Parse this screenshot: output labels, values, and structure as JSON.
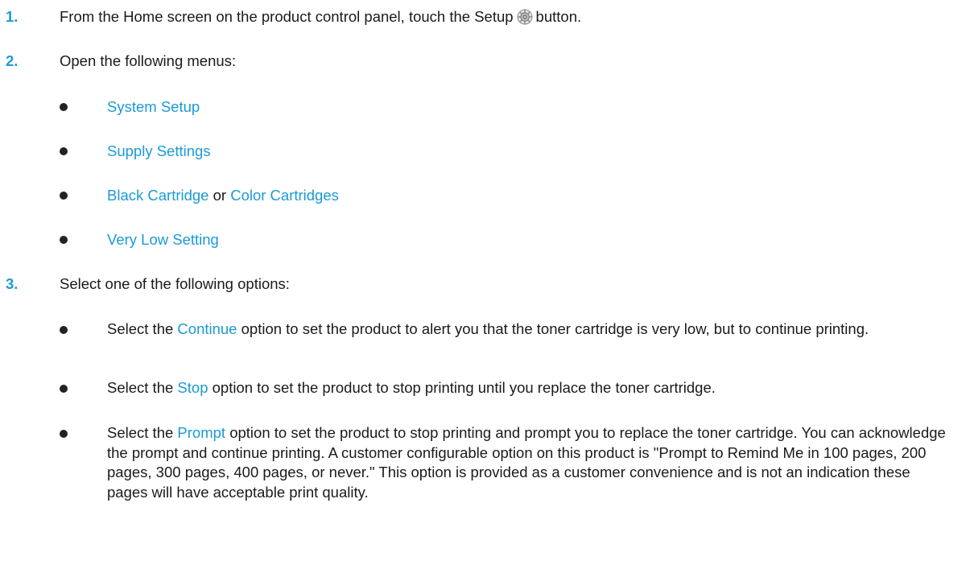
{
  "steps": [
    {
      "number": "1.",
      "before_icon": "From the Home screen on the product control panel, touch the Setup",
      "icon": "setup-gear-icon",
      "after_icon": "button."
    },
    {
      "number": "2.",
      "text": "Open the following menus:"
    },
    {
      "number": "3.",
      "text": "Select one of the following options:"
    }
  ],
  "menus": [
    {
      "term": "System Setup"
    },
    {
      "term": "Supply Settings"
    },
    {
      "term": "Black Cartridge",
      "connector": "or",
      "term2": "Color Cartridges"
    },
    {
      "term": "Very Low Setting"
    }
  ],
  "options": [
    {
      "prefix": "Select the",
      "term": "Continue",
      "suffix": "option to set the product to alert you that the toner cartridge is very low, but to continue printing."
    },
    {
      "prefix": "Select the",
      "term": "Stop",
      "suffix": "option to set the product to stop printing until you replace the toner cartridge."
    },
    {
      "prefix": "Select the",
      "term": "Prompt",
      "suffix": "option to set the product to stop printing and prompt you to replace the toner cartridge. You can acknowledge the prompt and continue printing. A customer configurable option on this product is \"Prompt to Remind Me in 100 pages, 200 pages, 300 pages, 400 pages, or never.\" This option is provided as a customer convenience and is not an indication these pages will have acceptable print quality."
    }
  ],
  "colors": {
    "accent": "#1b9ad6",
    "text": "#1a1a1a"
  }
}
